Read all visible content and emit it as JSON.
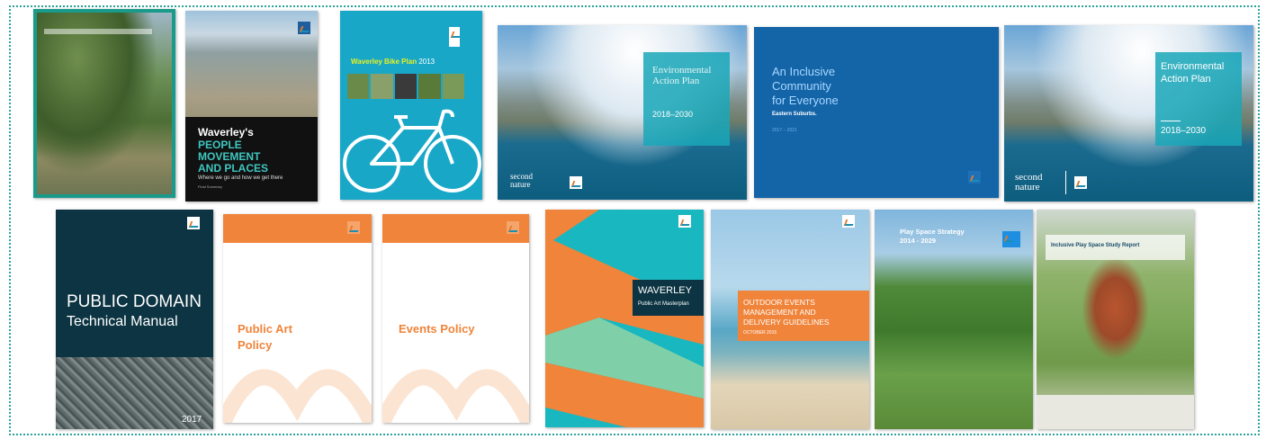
{
  "covers": {
    "c1": {
      "header": ""
    },
    "c2": {
      "title_line1": "Waverley's",
      "title_line2": "PEOPLE",
      "title_line3": "MOVEMENT",
      "title_line4": "AND PLACES",
      "subtitle": "Where we go and how we get there",
      "note": "Final Summary"
    },
    "c3": {
      "title": "Waverley Bike Plan",
      "year": "2013"
    },
    "c4": {
      "title_line1": "Environmental",
      "title_line2": "Action Plan",
      "years": "2018–2030",
      "brand_line1": "second",
      "brand_line2": "nature"
    },
    "c5": {
      "title_line1": "An Inclusive",
      "title_line2": "Community",
      "title_line3": "for Everyone",
      "subtitle": "Eastern Suburbs.",
      "years": "2017 – 2021"
    },
    "c6": {
      "title_line1": "Environmental",
      "title_line2": "Action Plan",
      "years": "2018–2030",
      "brand_line1": "second",
      "brand_line2": "nature"
    },
    "c7": {
      "title_line1": "PUBLIC DOMAIN",
      "title_line2": "Technical Manual",
      "year": "2017"
    },
    "c8": {
      "title_line1": "Public Art",
      "title_line2": "Policy"
    },
    "c9": {
      "title": "Events Policy"
    },
    "c10": {
      "title": "WAVERLEY",
      "subtitle": "Public Art Masterplan"
    },
    "c11": {
      "title_line1": "OUTDOOR EVENTS",
      "title_line2": "MANAGEMENT AND",
      "title_line3": "DELIVERY  GUIDELINES",
      "date": "OCTOBER 2015"
    },
    "c12": {
      "title_line1": "Play Space Strategy",
      "title_line2": "2014 - 2029"
    },
    "c13": {
      "title": "Inclusive Play Space Study Report"
    }
  },
  "colors": {
    "frame": "#2aa39a",
    "teal": "#19a7b8",
    "orange": "#f0843a",
    "navy": "#0c3442",
    "blue": "#1464a8",
    "green": "#7fbf4d"
  }
}
